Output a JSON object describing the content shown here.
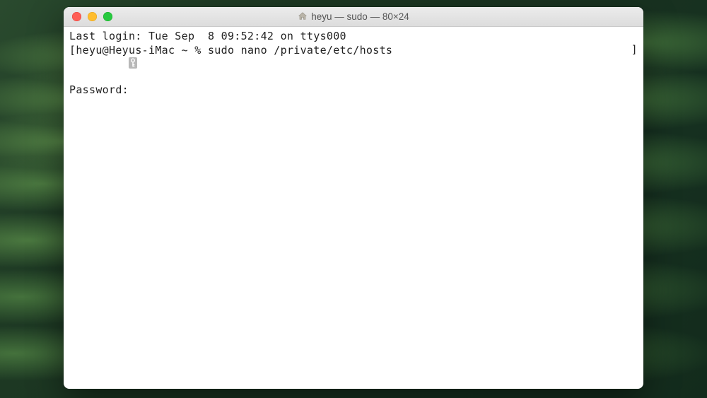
{
  "window": {
    "title": "heyu — sudo — 80×24"
  },
  "terminal": {
    "last_login": "Last login: Tue Sep  8 09:52:42 on ttys000",
    "bracket_left": "[",
    "prompt": "heyu@Heyus-iMac ~ % ",
    "command": "sudo nano /private/etc/hosts",
    "bracket_right": "]",
    "password_label": "Password:"
  },
  "colors": {
    "close": "#ff5f56",
    "minimize": "#ffbd2e",
    "maximize": "#27c93f"
  }
}
